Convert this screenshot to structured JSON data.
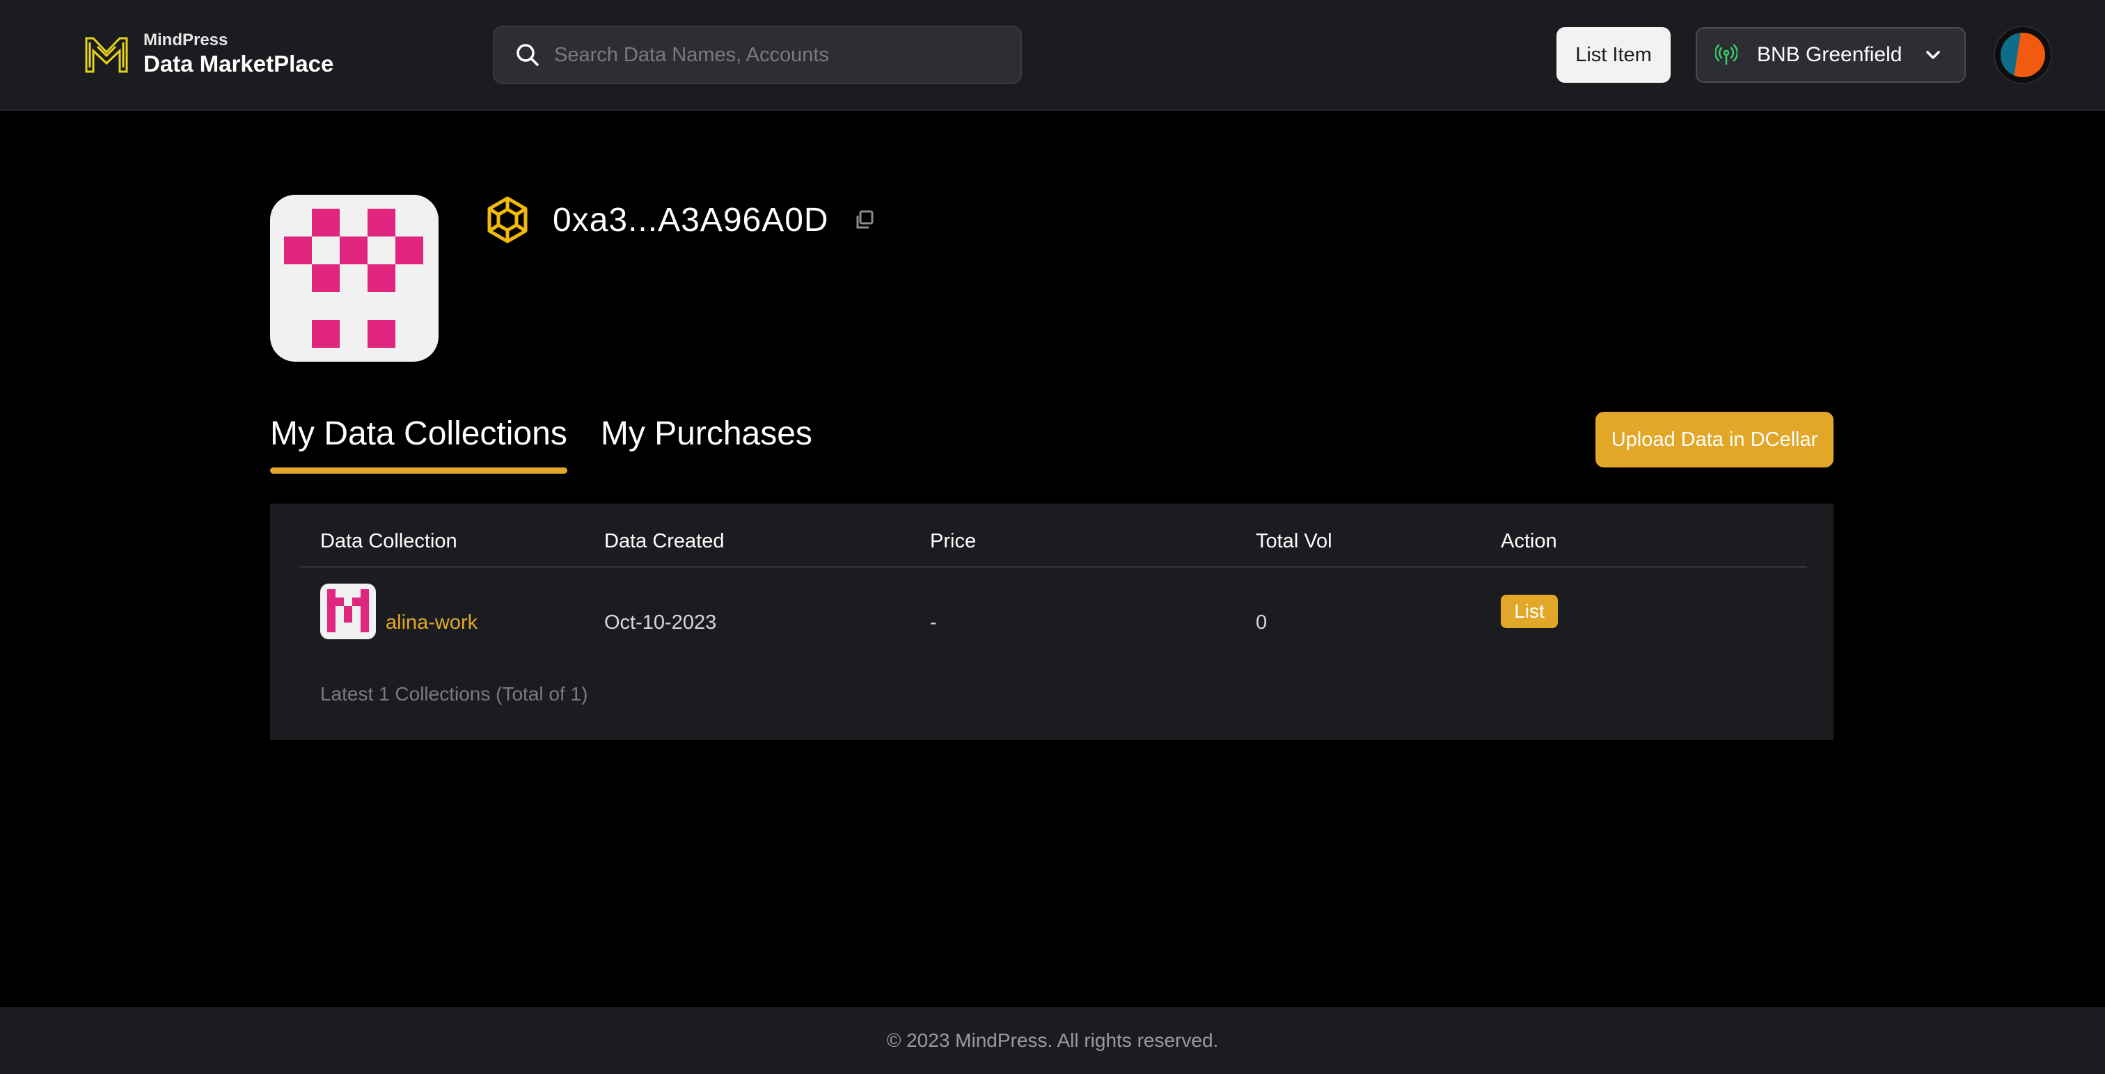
{
  "header": {
    "brand_sub": "MindPress",
    "brand_title": "Data MarketPlace",
    "search_placeholder": "Search Data Names, Accounts",
    "list_item_label": "List Item",
    "network_label": "BNB Greenfield"
  },
  "profile": {
    "address": "0xa3...A3A96A0D"
  },
  "tabs": [
    {
      "label": "My Data Collections",
      "active": true
    },
    {
      "label": "My Purchases",
      "active": false
    }
  ],
  "upload_label": "Upload Data in DCellar",
  "table": {
    "columns": [
      "Data Collection",
      "Data Created",
      "Price",
      "Total Vol",
      "Action"
    ],
    "rows": [
      {
        "name": "alina-work",
        "created": "Oct-10-2023",
        "price": "-",
        "total_vol": "0",
        "action": "List"
      }
    ],
    "footer": "Latest 1 Collections (Total of 1)"
  },
  "footer": {
    "text": "© 2023 MindPress. All rights reserved."
  },
  "colors": {
    "accent": "#e2a729",
    "header_bg": "#1b1c20",
    "page_bg": "#000000",
    "avatar_pink": "#e0267f",
    "network_green": "#3ccf6a"
  }
}
